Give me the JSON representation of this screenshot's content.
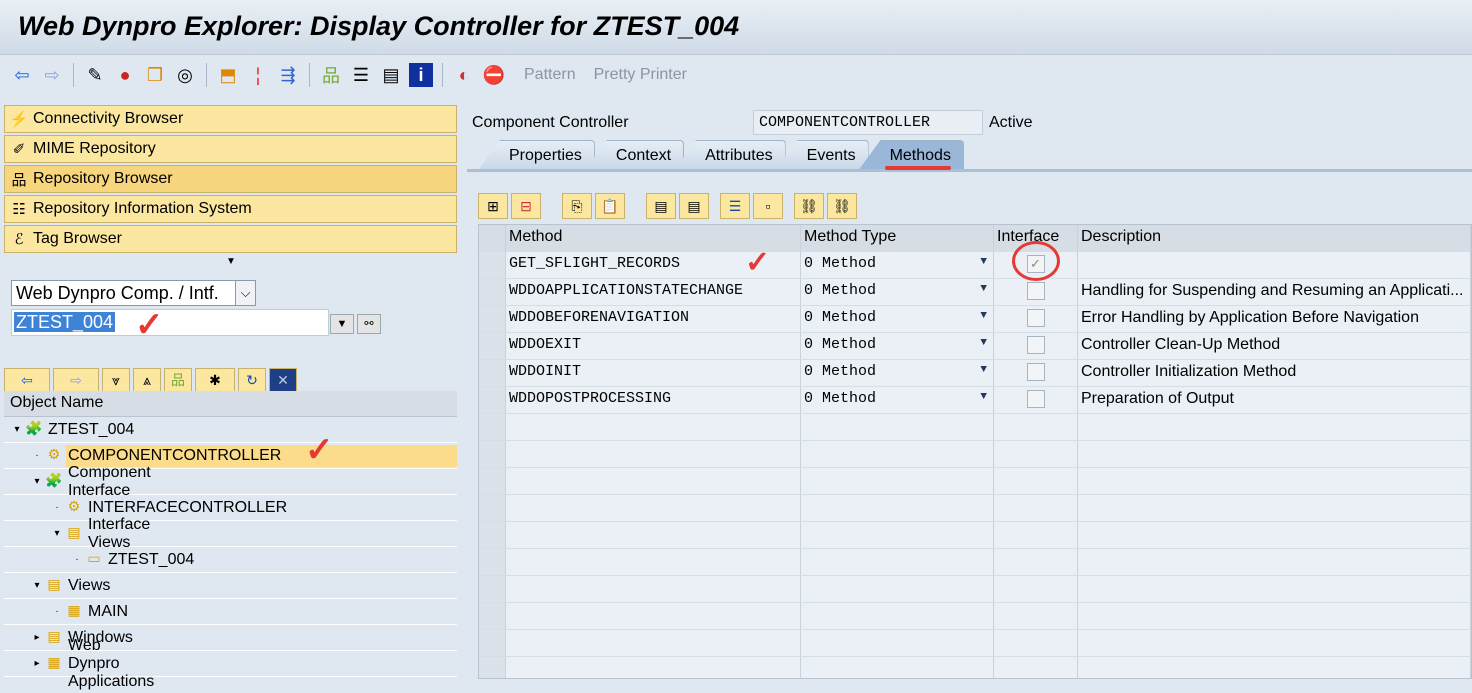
{
  "title": "Web Dynpro Explorer: Display Controller for ZTEST_004",
  "toolbar": {
    "pattern": "Pattern",
    "pretty_printer": "Pretty Printer"
  },
  "nav": [
    "Connectivity Browser",
    "MIME Repository",
    "Repository Browser",
    "Repository Information System",
    "Tag Browser"
  ],
  "object_type": "Web Dynpro Comp. / Intf.",
  "object_name": "ZTEST_004",
  "tree": {
    "header": "Object Name",
    "nodes": [
      {
        "label": "ZTEST_004",
        "level": 0,
        "exp": "▾",
        "icon": "🧩"
      },
      {
        "label": "COMPONENTCONTROLLER",
        "level": 1,
        "exp": "·",
        "icon": "⚙"
      },
      {
        "label": "Component Interface",
        "level": 1,
        "exp": "▾",
        "icon": "🧩"
      },
      {
        "label": "INTERFACECONTROLLER",
        "level": 2,
        "exp": "·",
        "icon": "⚙"
      },
      {
        "label": "Interface Views",
        "level": 2,
        "exp": "▾",
        "icon": "▤"
      },
      {
        "label": "ZTEST_004",
        "level": 3,
        "exp": "·",
        "icon": "▭"
      },
      {
        "label": "Views",
        "level": 1,
        "exp": "▾",
        "icon": "▤"
      },
      {
        "label": "MAIN",
        "level": 2,
        "exp": "·",
        "icon": "▦"
      },
      {
        "label": "Windows",
        "level": 1,
        "exp": "▸",
        "icon": "▤"
      },
      {
        "label": "Web Dynpro Applications",
        "level": 1,
        "exp": "▸",
        "icon": "▦"
      }
    ]
  },
  "controller": {
    "label": "Component Controller",
    "value": "COMPONENTCONTROLLER",
    "status": "Active"
  },
  "tabs": [
    "Properties",
    "Context",
    "Attributes",
    "Events",
    "Methods"
  ],
  "active_tab": "Methods",
  "grid": {
    "headers": [
      "Method",
      "Method Type",
      "Interface",
      "Description"
    ],
    "rows": [
      {
        "method": "GET_SFLIGHT_RECORDS",
        "type": "0 Method",
        "interface": true,
        "desc": ""
      },
      {
        "method": "WDDOAPPLICATIONSTATECHANGE",
        "type": "0 Method",
        "interface": false,
        "desc": "Handling for Suspending and Resuming an Applicati..."
      },
      {
        "method": "WDDOBEFORENAVIGATION",
        "type": "0 Method",
        "interface": false,
        "desc": "Error Handling by Application Before Navigation"
      },
      {
        "method": "WDDOEXIT",
        "type": "0 Method",
        "interface": false,
        "desc": "Controller Clean-Up Method"
      },
      {
        "method": "WDDOINIT",
        "type": "0 Method",
        "interface": false,
        "desc": "Controller Initialization Method"
      },
      {
        "method": "WDDOPOSTPROCESSING",
        "type": "0 Method",
        "interface": false,
        "desc": "Preparation of Output"
      }
    ]
  }
}
